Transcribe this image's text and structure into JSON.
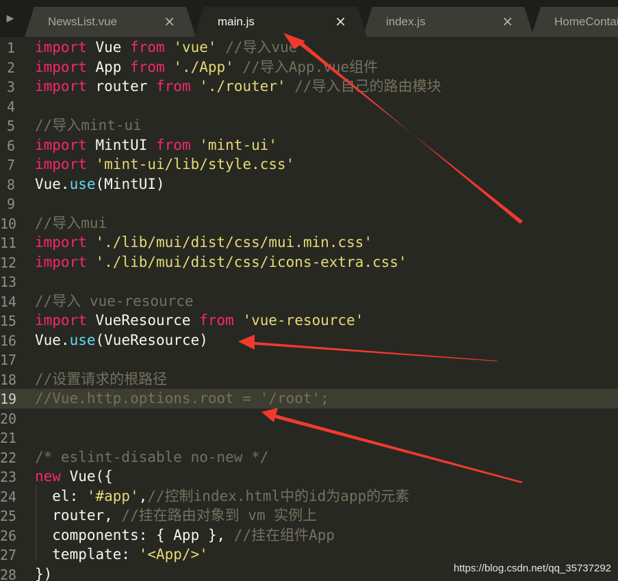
{
  "tabs": [
    {
      "label": "NewsList.vue",
      "close": "×",
      "active": false
    },
    {
      "label": "main.js",
      "close": "×",
      "active": true
    },
    {
      "label": "index.js",
      "close": "×",
      "active": false
    },
    {
      "label": "HomeContainer",
      "close": "",
      "active": false
    }
  ],
  "sidebar_toggle": "▶",
  "current_line": 19,
  "lines": [
    {
      "n": "1",
      "tokens": [
        [
          "kw",
          "import"
        ],
        [
          "plain",
          " Vue "
        ],
        [
          "kw",
          "from"
        ],
        [
          "plain",
          " "
        ],
        [
          "str",
          "'vue'"
        ],
        [
          "plain",
          " "
        ],
        [
          "cmt",
          "//导入vue"
        ]
      ]
    },
    {
      "n": "2",
      "tokens": [
        [
          "kw",
          "import"
        ],
        [
          "plain",
          " App "
        ],
        [
          "kw",
          "from"
        ],
        [
          "plain",
          " "
        ],
        [
          "str",
          "'./App'"
        ],
        [
          "plain",
          " "
        ],
        [
          "cmt",
          "//导入App.vue组件"
        ]
      ]
    },
    {
      "n": "3",
      "tokens": [
        [
          "kw",
          "import"
        ],
        [
          "plain",
          " router "
        ],
        [
          "kw",
          "from"
        ],
        [
          "plain",
          " "
        ],
        [
          "str",
          "'./router'"
        ],
        [
          "plain",
          " "
        ],
        [
          "cmt",
          "//导入自己的路由模块"
        ]
      ]
    },
    {
      "n": "4",
      "tokens": []
    },
    {
      "n": "5",
      "tokens": [
        [
          "cmt",
          "//导入mint-ui"
        ]
      ]
    },
    {
      "n": "6",
      "tokens": [
        [
          "kw",
          "import"
        ],
        [
          "plain",
          " MintUI "
        ],
        [
          "kw",
          "from"
        ],
        [
          "plain",
          " "
        ],
        [
          "str",
          "'mint-ui'"
        ]
      ]
    },
    {
      "n": "7",
      "tokens": [
        [
          "kw",
          "import"
        ],
        [
          "plain",
          " "
        ],
        [
          "str",
          "'mint-ui/lib/style.css'"
        ]
      ]
    },
    {
      "n": "8",
      "tokens": [
        [
          "plain",
          "Vue."
        ],
        [
          "fn",
          "use"
        ],
        [
          "plain",
          "(MintUI)"
        ]
      ]
    },
    {
      "n": "9",
      "tokens": []
    },
    {
      "n": "10",
      "tokens": [
        [
          "cmt",
          "//导入mui"
        ]
      ]
    },
    {
      "n": "11",
      "tokens": [
        [
          "kw",
          "import"
        ],
        [
          "plain",
          " "
        ],
        [
          "str",
          "'./lib/mui/dist/css/mui.min.css'"
        ]
      ]
    },
    {
      "n": "12",
      "tokens": [
        [
          "kw",
          "import"
        ],
        [
          "plain",
          " "
        ],
        [
          "str",
          "'./lib/mui/dist/css/icons-extra.css'"
        ]
      ]
    },
    {
      "n": "13",
      "tokens": []
    },
    {
      "n": "14",
      "tokens": [
        [
          "cmt",
          "//导入 vue-resource"
        ]
      ]
    },
    {
      "n": "15",
      "tokens": [
        [
          "kw",
          "import"
        ],
        [
          "plain",
          " VueResource "
        ],
        [
          "kw",
          "from"
        ],
        [
          "plain",
          " "
        ],
        [
          "str",
          "'vue-resource'"
        ]
      ]
    },
    {
      "n": "16",
      "tokens": [
        [
          "plain",
          "Vue."
        ],
        [
          "fn",
          "use"
        ],
        [
          "plain",
          "(VueResource)"
        ]
      ]
    },
    {
      "n": "17",
      "tokens": []
    },
    {
      "n": "18",
      "tokens": [
        [
          "cmt",
          "//设置请求的根路径"
        ]
      ]
    },
    {
      "n": "19",
      "tokens": [
        [
          "cmt",
          "//Vue.http.options.root = '/root';"
        ]
      ]
    },
    {
      "n": "20",
      "tokens": []
    },
    {
      "n": "21",
      "tokens": []
    },
    {
      "n": "22",
      "tokens": [
        [
          "cmt",
          "/* eslint-disable no-new */"
        ]
      ]
    },
    {
      "n": "23",
      "tokens": [
        [
          "kw",
          "new"
        ],
        [
          "plain",
          " Vue({"
        ]
      ]
    },
    {
      "n": "24",
      "tokens": [
        [
          "plain",
          "  el: "
        ],
        [
          "str",
          "'#app'"
        ],
        [
          "plain",
          ","
        ],
        [
          "cmt",
          "//控制index.html中的id为app的元素"
        ]
      ]
    },
    {
      "n": "25",
      "tokens": [
        [
          "plain",
          "  router, "
        ],
        [
          "cmt",
          "//挂在路由对象到 vm 实例上"
        ]
      ]
    },
    {
      "n": "26",
      "tokens": [
        [
          "plain",
          "  components: { App }, "
        ],
        [
          "cmt",
          "//挂在组件App"
        ]
      ]
    },
    {
      "n": "27",
      "tokens": [
        [
          "plain",
          "  template: "
        ],
        [
          "str",
          "'<App/>'"
        ]
      ]
    },
    {
      "n": "28",
      "tokens": [
        [
          "plain",
          "})"
        ]
      ]
    }
  ],
  "watermark": "https://blog.csdn.net/qq_35737292",
  "colors": {
    "background": "#272822",
    "keyword": "#f92672",
    "string": "#e6db74",
    "comment": "#75715e",
    "function": "#66d9ef",
    "annotation_arrow": "#f03a2e"
  }
}
